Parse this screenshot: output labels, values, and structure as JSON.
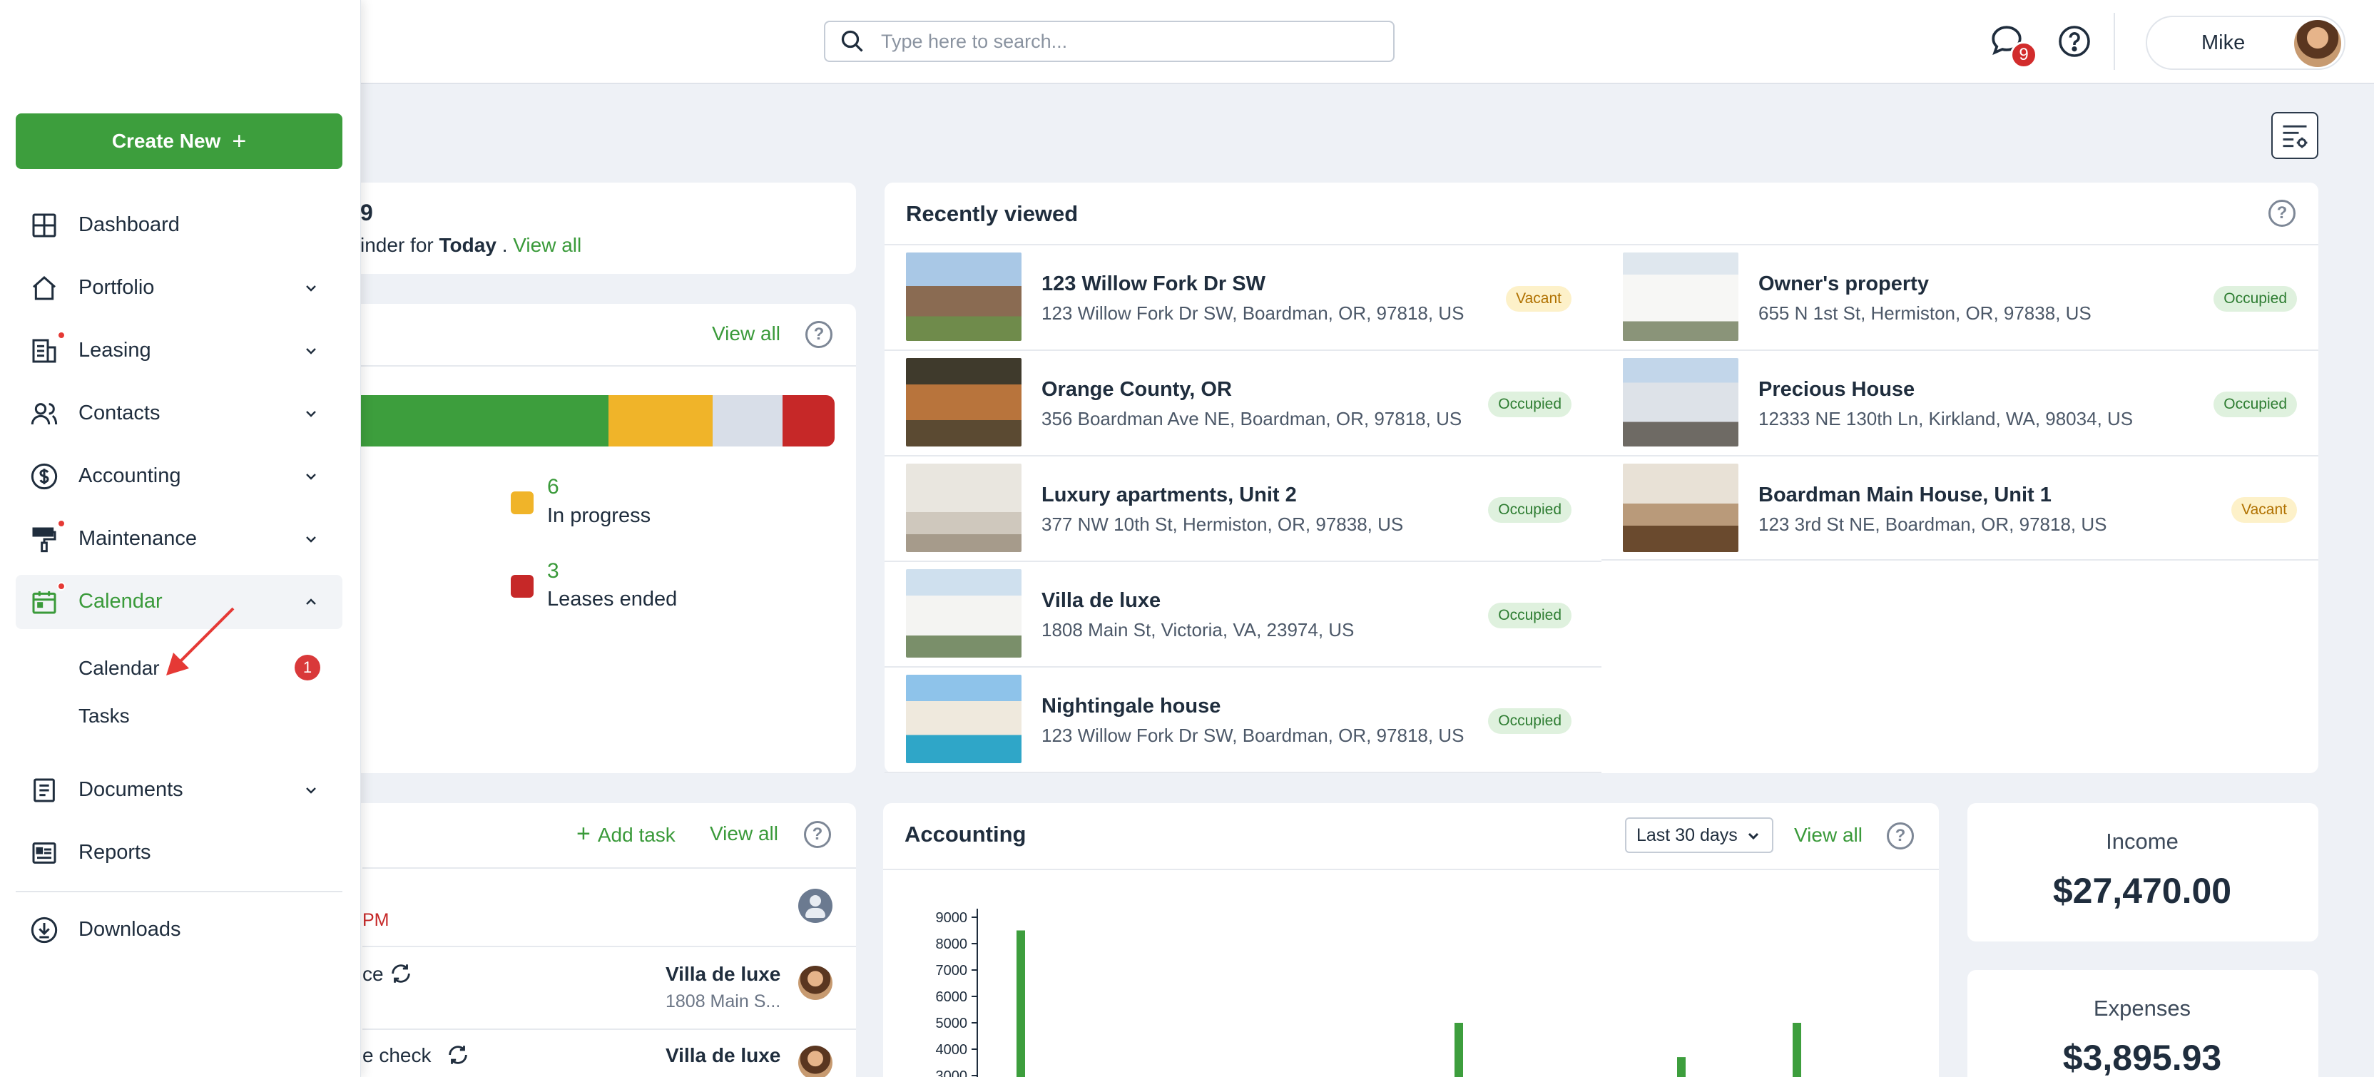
{
  "header": {
    "search_placeholder": "Type here to search...",
    "chat_count": "9",
    "user_name": "Mike"
  },
  "sidebar": {
    "create_new": "Create New",
    "items": [
      {
        "label": "Dashboard",
        "icon": "dashboard-icon"
      },
      {
        "label": "Portfolio",
        "icon": "house-icon"
      },
      {
        "label": "Leasing",
        "icon": "leasing-icon"
      },
      {
        "label": "Contacts",
        "icon": "contacts-icon"
      },
      {
        "label": "Accounting",
        "icon": "dollar-icon"
      },
      {
        "label": "Maintenance",
        "icon": "paint-roller-icon"
      },
      {
        "label": "Calendar",
        "icon": "calendar-icon"
      },
      {
        "label": "Documents",
        "icon": "document-icon"
      },
      {
        "label": "Reports",
        "icon": "reports-icon"
      },
      {
        "label": "Downloads",
        "icon": "download-icon"
      }
    ],
    "calendar_sub": [
      {
        "label": "Calendar",
        "badge": "1"
      },
      {
        "label": "Tasks"
      }
    ]
  },
  "reminders": {
    "title_partial": "9",
    "text_partial": "inder",
    "for_text": "for",
    "period": "Today",
    "dot": ".",
    "view_all": "View all"
  },
  "leases": {
    "view_all": "View all",
    "in_progress_count": "6",
    "in_progress_label": "In progress",
    "ended_count": "3",
    "ended_label": "Leases ended"
  },
  "recently_viewed": {
    "title": "Recently viewed",
    "left": [
      {
        "name": "123 Willow Fork Dr SW",
        "address": "123 Willow Fork Dr SW, Boardman, OR, 97818, US",
        "status": "Vacant"
      },
      {
        "name": "Orange County, OR",
        "address": "356 Boardman Ave NE, Boardman, OR, 97818, US",
        "status": "Occupied"
      },
      {
        "name": "Luxury apartments, Unit 2",
        "address": "377 NW 10th St, Hermiston, OR, 97838, US",
        "status": "Occupied"
      },
      {
        "name": "Villa de luxe",
        "address": "1808 Main St, Victoria, VA, 23974, US",
        "status": "Occupied"
      },
      {
        "name": "Nightingale house",
        "address": "123 Willow Fork Dr SW, Boardman, OR, 97818, US",
        "status": "Occupied"
      }
    ],
    "right": [
      {
        "name": "Owner's property",
        "address": "655 N 1st St, Hermiston, OR, 97838, US",
        "status": "Occupied"
      },
      {
        "name": "Precious House",
        "address": "12333 NE 130th Ln, Kirkland, WA, 98034, US",
        "status": "Occupied"
      },
      {
        "name": "Boardman Main House, Unit 1",
        "address": "123 3rd St NE, Boardman, OR, 97818, US",
        "status": "Vacant"
      }
    ]
  },
  "tasks": {
    "add_task": "Add task",
    "view_all": "View all",
    "time_partial": "PM",
    "rows": [
      {
        "title_partial": "ce",
        "property": "Villa de luxe",
        "address": "1808 Main S..."
      },
      {
        "title_partial": "e check",
        "property": "Villa de luxe"
      }
    ]
  },
  "accounting": {
    "title": "Accounting",
    "period": "Last 30 days",
    "view_all": "View all",
    "income_label": "Income",
    "income_value": "$27,470.00",
    "expenses_label": "Expenses",
    "expenses_value": "$3,895.93"
  },
  "chart_data": {
    "type": "bar",
    "y_ticks": [
      "9000",
      "8000",
      "7000",
      "6000",
      "5000",
      "4000",
      "3000"
    ],
    "ylim": [
      3000,
      9000
    ],
    "values": [
      8500,
      5000,
      3700,
      5000
    ]
  },
  "colors": {
    "brand_green": "#3d9e3d",
    "lease_active": "#3d9e3d",
    "lease_in_progress": "#f0b429",
    "lease_other": "#d8dee8",
    "lease_ended": "#c62828"
  }
}
